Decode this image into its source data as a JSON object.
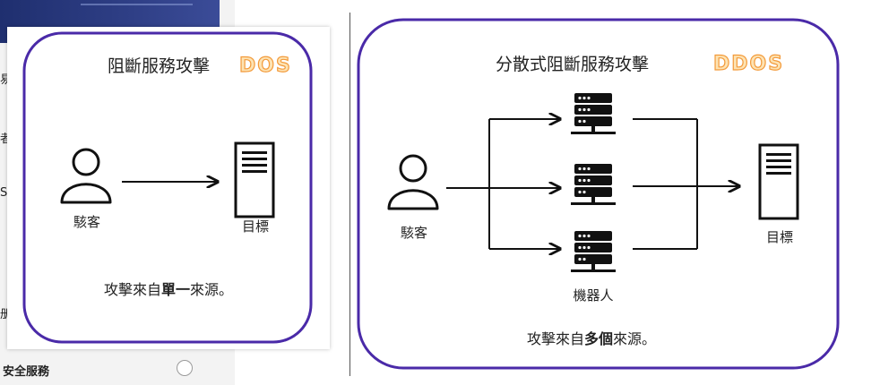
{
  "sidebar": {
    "peeks": [
      "易",
      "者",
      "S",
      "册"
    ],
    "footer_label": "安全服務"
  },
  "dos_panel": {
    "title": "阻斷服務攻擊",
    "badge": "DOS",
    "attacker_label": "駭客",
    "target_label": "目標",
    "caption_pre": "攻擊來自",
    "caption_bold": "單一",
    "caption_post": "來源。"
  },
  "ddos_panel": {
    "title": "分散式阻斷服務攻擊",
    "badge": "DDOS",
    "attacker_label": "駭客",
    "target_label": "目標",
    "bots_label": "機器人",
    "caption_pre": "攻擊來自",
    "caption_bold": "多個",
    "caption_post": "來源。"
  },
  "colors": {
    "panel_border": "#4a2aa8",
    "badge_fill": "#fde3b3",
    "badge_stroke": "#f39a3a",
    "header": "#2a3a80"
  }
}
